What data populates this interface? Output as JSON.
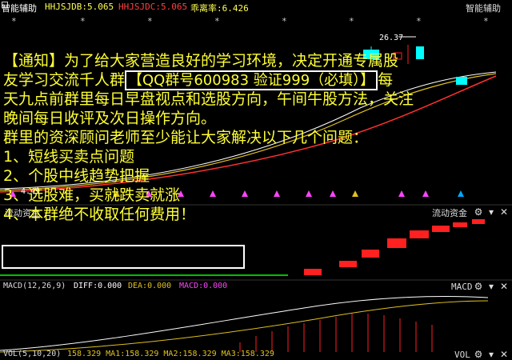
{
  "topbar": {
    "app_name": "智能辅助",
    "indicator1": "HHJSJDB:5.065",
    "indicator2": "HHJSJDC:5.065",
    "indicator3": "乖离率:6.426",
    "right_title": "智能辅助"
  },
  "chart": {
    "peak_label": "26.37",
    "low_label": "4.49"
  },
  "panels": {
    "fund_flow_left": "流动资金",
    "fund_flow_right": "流动资金",
    "macd_left": "MACD(12,26,9)",
    "macd_diff": "DIFF:0.000",
    "macd_dea": "DEA:0.000",
    "macd_macd": "MACD:0.000",
    "macd_right": "MACD",
    "vol_left": "VOL(5,10,20)",
    "vol_values": "158.329  MA1:158.329  MA2:158.329  MA3:158.329",
    "vol_right": "VOL"
  },
  "notice": {
    "line1": "【通知】为了给大家营造良好的学习环境，决定开通专属股",
    "line2_a": "友学习交流千人群",
    "line2_box": "【QQ群号600983 验证999（必填）】",
    "line2_b": "每",
    "line3": "天九点前群里每日早盘视点和选股方向，午间牛股方法，关注",
    "line4": "晚间每日收评及次日操作方向。",
    "line5": "群里的资深顾问老师至少能让大家解决以下几个问题：",
    "item1": "1、短线买卖点问题",
    "item2": "2、个股中线趋势把握",
    "item3": "3、选股难，买就跌卖就涨",
    "item4": "4、本群绝不收取任何费用！"
  },
  "colors": {
    "up": "#ff2020",
    "down": "#00ffff",
    "notice_text": "#ffff33",
    "magenta": "#ff44ff",
    "gold": "#e0c020"
  }
}
